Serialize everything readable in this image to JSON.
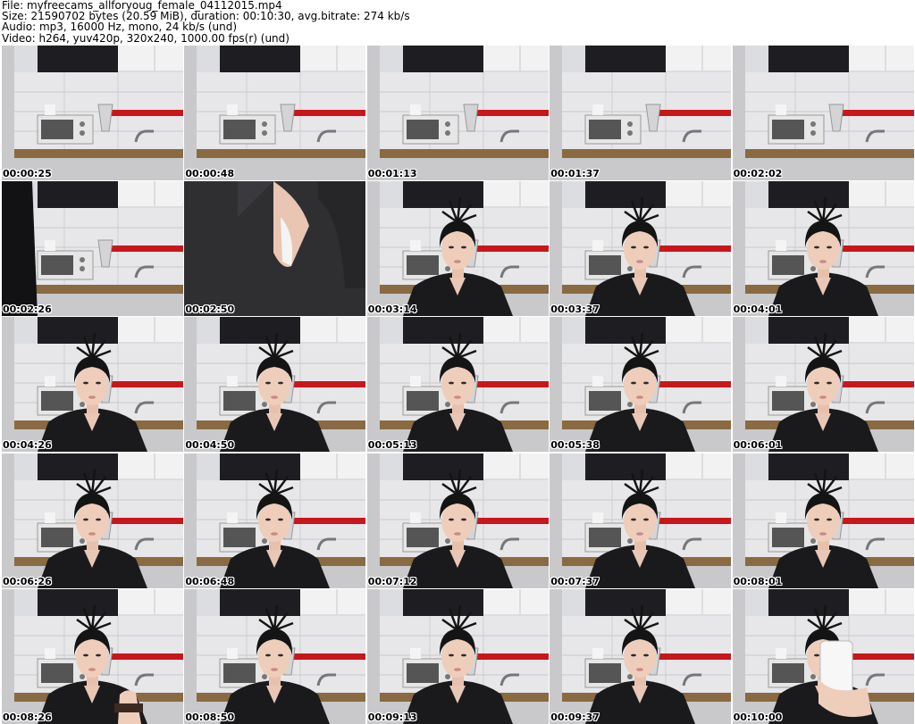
{
  "header": {
    "file": "File: myfreecams_allforyoug_female_04112015.mp4",
    "size": "Size: 21590702 bytes (20.59 MiB), duration: 00:10:30, avg.bitrate: 274 kb/s",
    "audio": "Audio: mp3, 16000 Hz, mono, 24 kb/s (und)",
    "video": "Video: h264, yuv420p, 320x240, 1000.00 fps(r) (und)"
  },
  "thumbnails": [
    {
      "time": "00:00:25",
      "scene": "empty"
    },
    {
      "time": "00:00:48",
      "scene": "empty"
    },
    {
      "time": "00:01:13",
      "scene": "empty"
    },
    {
      "time": "00:01:37",
      "scene": "empty"
    },
    {
      "time": "00:02:02",
      "scene": "empty"
    },
    {
      "time": "00:02:26",
      "scene": "arm"
    },
    {
      "time": "00:02:50",
      "scene": "closeup"
    },
    {
      "time": "00:03:14",
      "scene": "person"
    },
    {
      "time": "00:03:37",
      "scene": "person"
    },
    {
      "time": "00:04:01",
      "scene": "person"
    },
    {
      "time": "00:04:26",
      "scene": "person"
    },
    {
      "time": "00:04:50",
      "scene": "person"
    },
    {
      "time": "00:05:13",
      "scene": "person"
    },
    {
      "time": "00:05:38",
      "scene": "person"
    },
    {
      "time": "00:06:01",
      "scene": "person"
    },
    {
      "time": "00:06:26",
      "scene": "person"
    },
    {
      "time": "00:06:48",
      "scene": "person"
    },
    {
      "time": "00:07:12",
      "scene": "person"
    },
    {
      "time": "00:07:37",
      "scene": "person"
    },
    {
      "time": "00:08:01",
      "scene": "person"
    },
    {
      "time": "00:08:26",
      "scene": "person-hand"
    },
    {
      "time": "00:08:50",
      "scene": "person"
    },
    {
      "time": "00:09:13",
      "scene": "person"
    },
    {
      "time": "00:09:37",
      "scene": "person"
    },
    {
      "time": "00:10:00",
      "scene": "phone"
    }
  ]
}
